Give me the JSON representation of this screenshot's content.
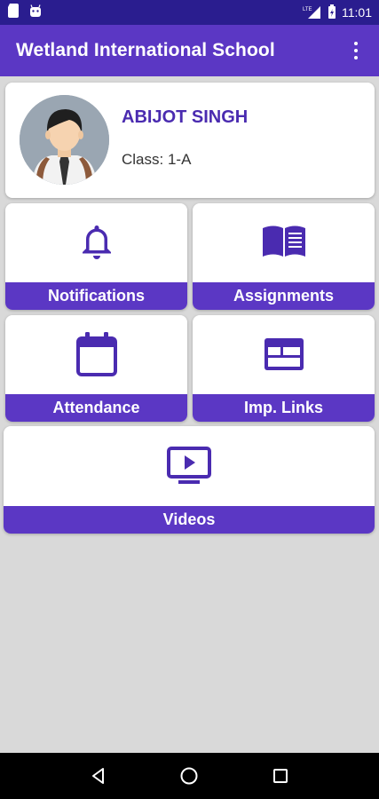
{
  "status_bar": {
    "time": "11:01",
    "network_label": "LTE",
    "icons": [
      "sd-card-icon",
      "android-icon",
      "signal-icon",
      "battery-icon"
    ]
  },
  "app_bar": {
    "title": "Wetland International School",
    "menu_icon": "overflow-menu-icon"
  },
  "profile": {
    "name": "ABIJOT SINGH",
    "class_text": "Class: 1-A",
    "avatar": "student-avatar"
  },
  "tiles": {
    "notifications": {
      "label": "Notifications",
      "icon": "bell-icon"
    },
    "assignments": {
      "label": "Assignments",
      "icon": "book-icon"
    },
    "attendance": {
      "label": "Attendance",
      "icon": "calendar-icon"
    },
    "imp_links": {
      "label": "Imp. Links",
      "icon": "web-layout-icon"
    },
    "videos": {
      "label": "Videos",
      "icon": "video-play-icon"
    }
  },
  "colors": {
    "primary": "#5b37c4",
    "primary_dark": "#2a1d8f",
    "name_text": "#4a2bb0",
    "background": "#d9d9d9"
  },
  "nav_bar": {
    "buttons": [
      "back-icon",
      "home-icon",
      "recents-icon"
    ]
  }
}
